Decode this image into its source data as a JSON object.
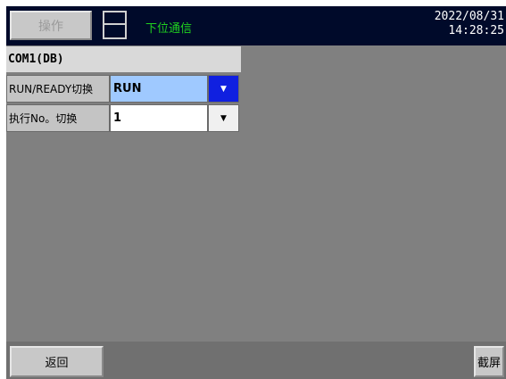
{
  "header": {
    "operate_label": "操作",
    "status_text": "下位通信",
    "date": "2022/08/31",
    "time": "14:28:25",
    "status_color": "#20d020"
  },
  "section": {
    "title": "COM1(DB)"
  },
  "rows": [
    {
      "label": "RUN/READY切换",
      "value": "RUN",
      "highlighted": true
    },
    {
      "label": "执行No。切换",
      "value": "1",
      "highlighted": false
    }
  ],
  "footer": {
    "back_label": "返回",
    "screenshot_label": "截屏"
  },
  "icons": {
    "storage": "floppy-disk-icon",
    "dropdown": "triangle-down-icon"
  },
  "colors": {
    "topbar": "#000a2a",
    "background": "#808080",
    "selected_value_bg": "#9fc9ff",
    "selected_arrow_bg": "#1020e0"
  }
}
